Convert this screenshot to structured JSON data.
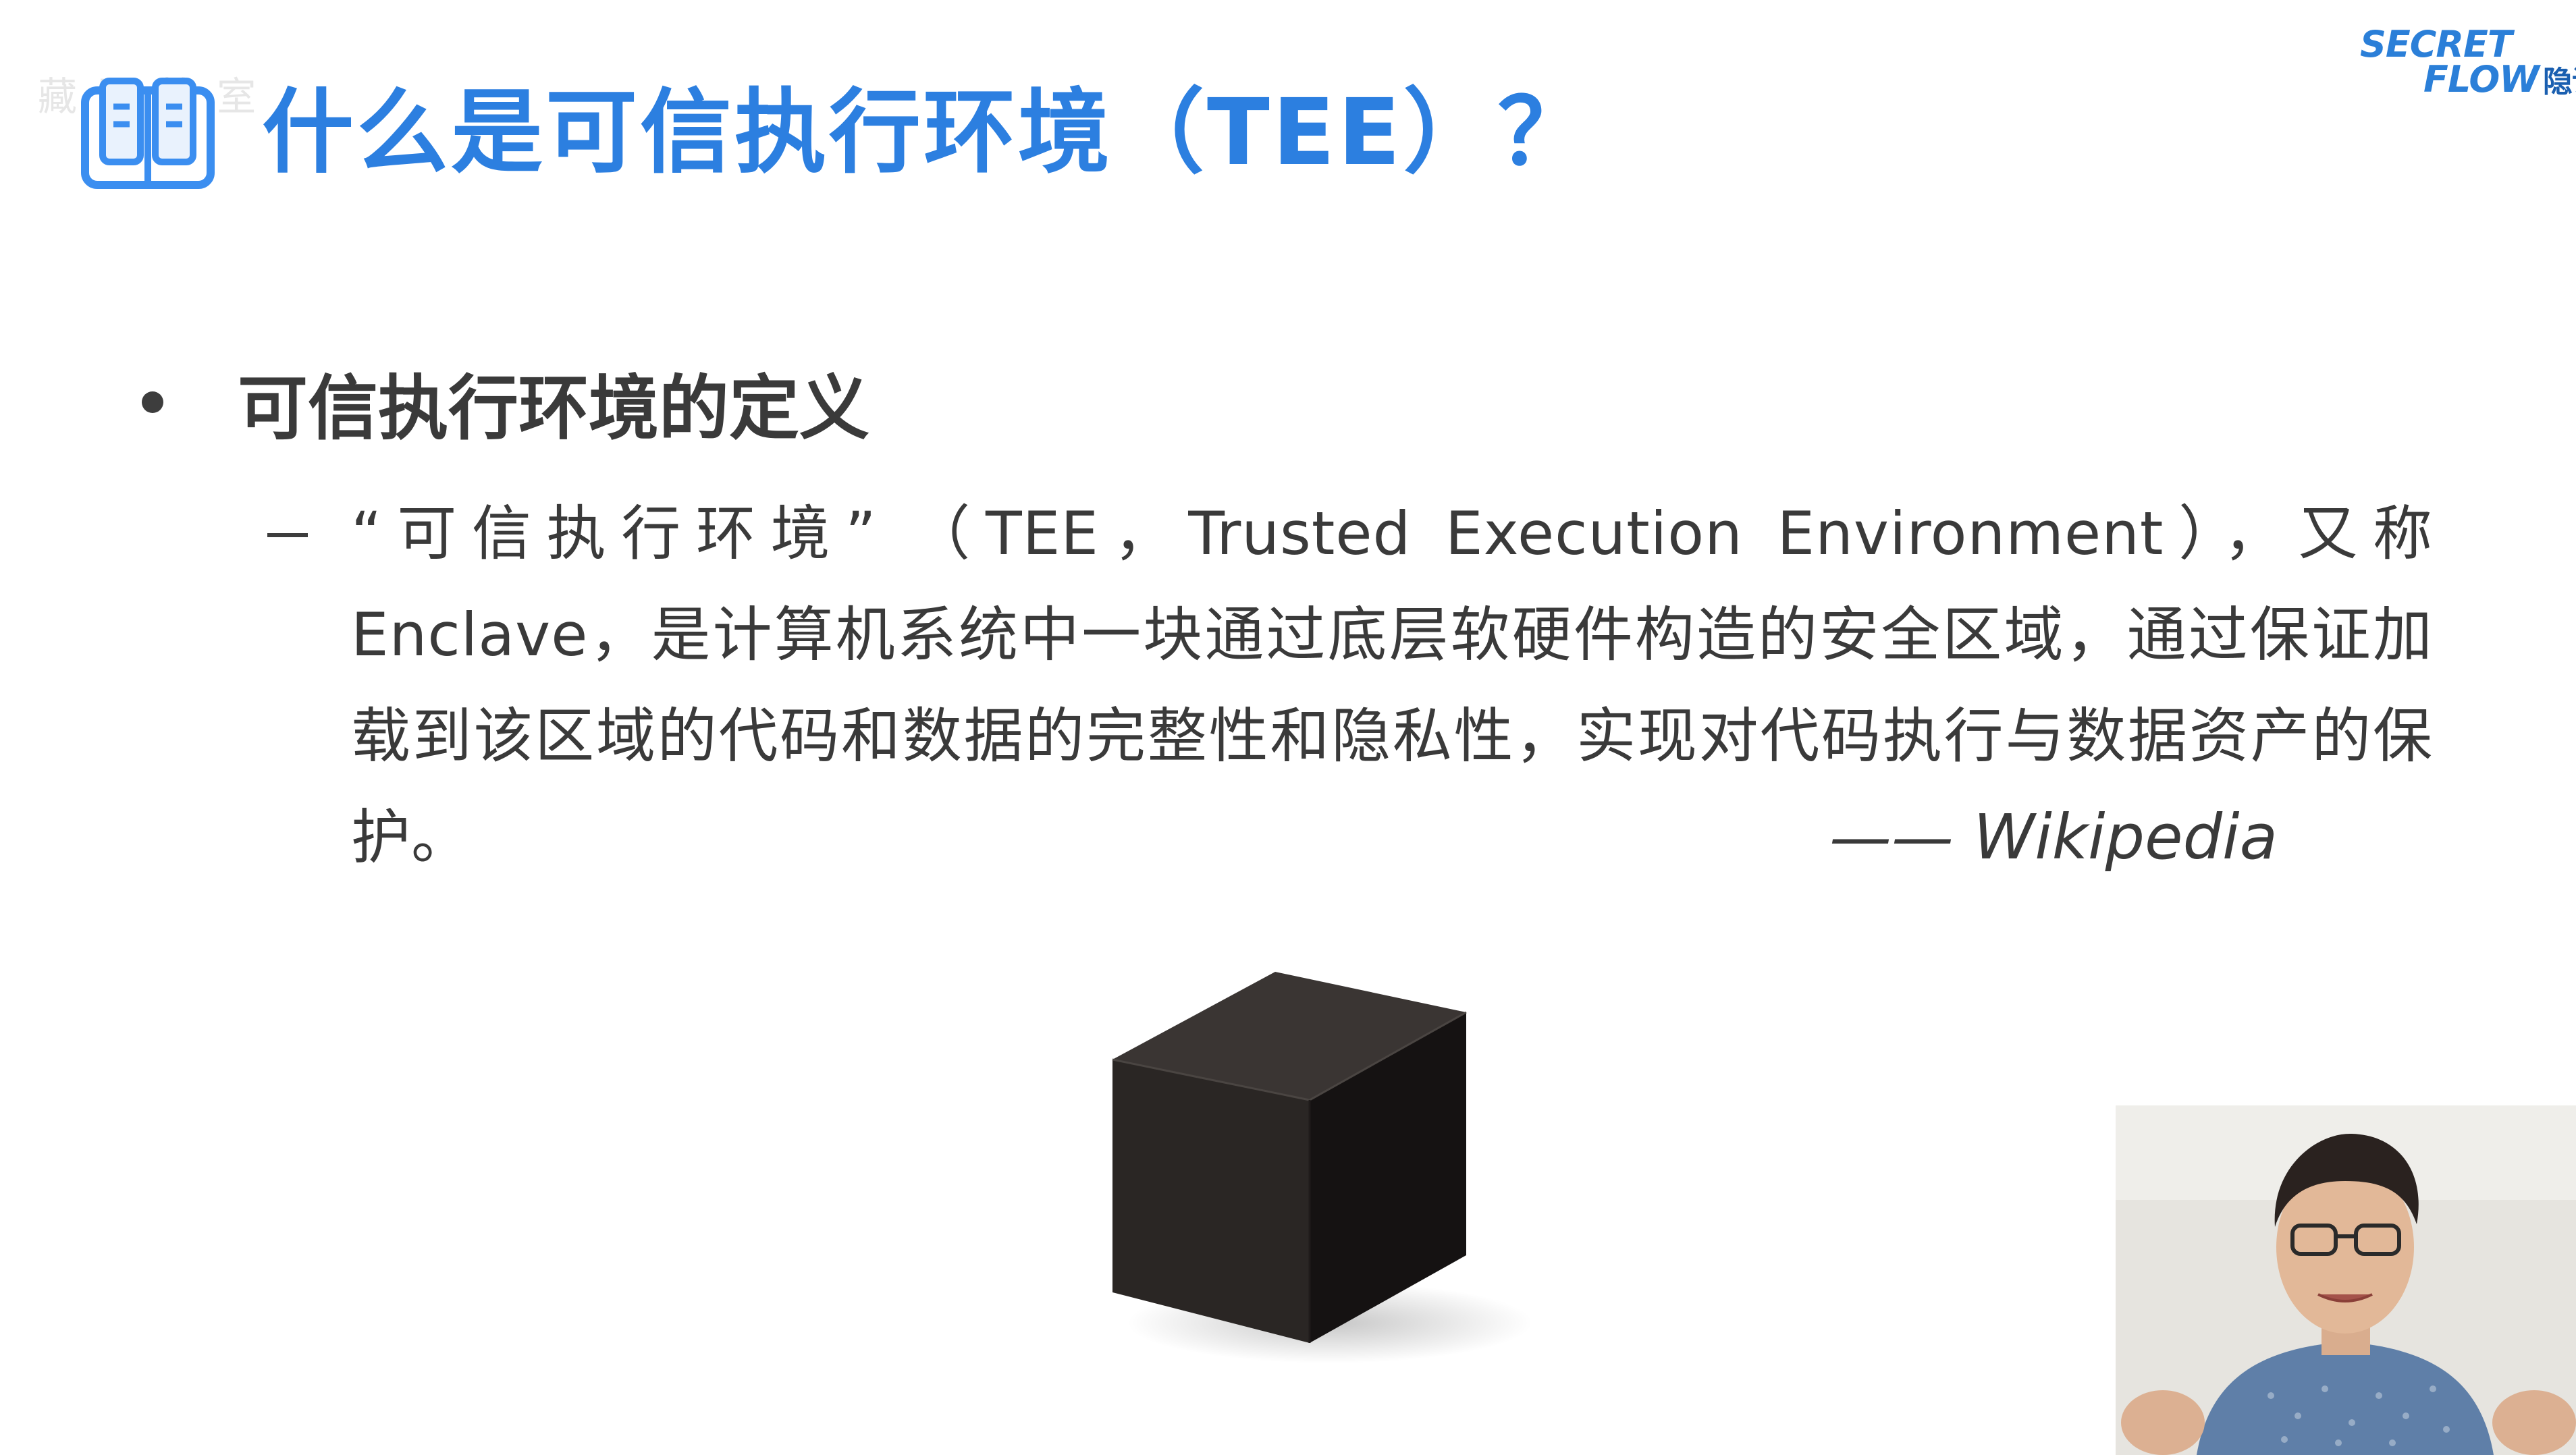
{
  "slide": {
    "title": "什么是可信执行环境（TEE）？",
    "title_icon": "open-book-icon",
    "accent_color": "#2c7fe0",
    "watermark_text": "藏 图 教 室"
  },
  "logo": {
    "line1": "SECRET",
    "line2": "FLOW",
    "cn": "隐语",
    "color": "#2b7fd8"
  },
  "section": {
    "heading": "可信执行环境的定义",
    "definition": "“可信执行环境” （TEE，Trusted Execution Environment），又称Enclave，是计算机系统中一块通过底层软硬件构造的安全区域，通过保证加载到该区域的代码和数据的完整性和隐私性，实现对代码执行与数据资产的保护。",
    "attribution": "—— Wikipedia"
  },
  "illustration": {
    "type": "black-cube-icon"
  },
  "presenter": {
    "type": "presenter-video-feed"
  }
}
